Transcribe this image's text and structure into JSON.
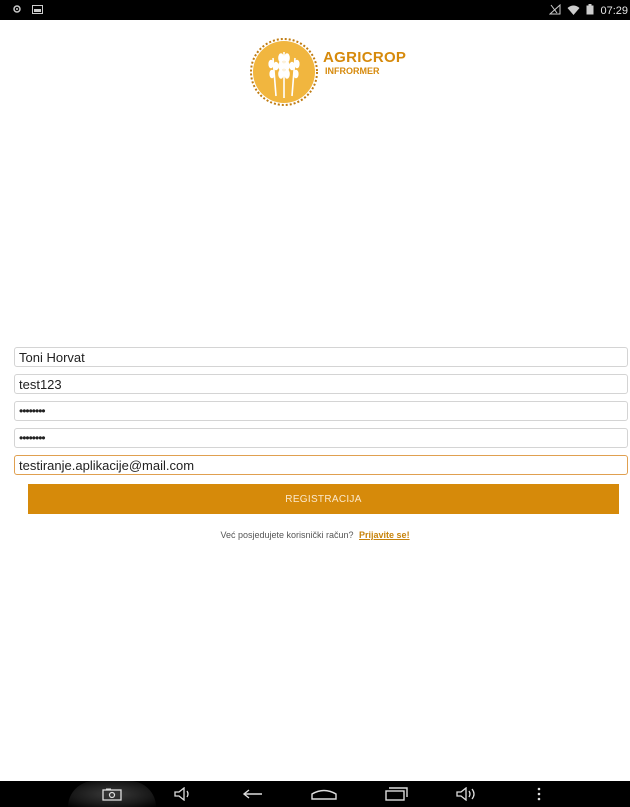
{
  "status_bar": {
    "time": "07:29",
    "left_icons": [
      "settings-icon",
      "gallery-icon"
    ],
    "right_icons": [
      "signal-off-icon",
      "wifi-icon",
      "battery-icon"
    ]
  },
  "logo": {
    "title": "AGRICROP",
    "subtitle": "INFRORMER",
    "color": "#d68a0c"
  },
  "form": {
    "name_value": "Toni Horvat",
    "username_value": "test123",
    "password_value": "••••••••",
    "confirm_password_value": "••••••••",
    "email_value": "testiranje.aplikacije@mail.com",
    "register_label": "REGISTRACIJA",
    "accent_color": "#d68a0a"
  },
  "login_prompt": {
    "text": "Već posjedujete korisnički račun?",
    "link": "Prijavite se!"
  },
  "nav_bar": {
    "buttons": [
      "screenshot-icon",
      "volume-down-icon",
      "back-icon",
      "home-icon",
      "recent-apps-icon",
      "volume-up-icon",
      "menu-icon"
    ]
  }
}
